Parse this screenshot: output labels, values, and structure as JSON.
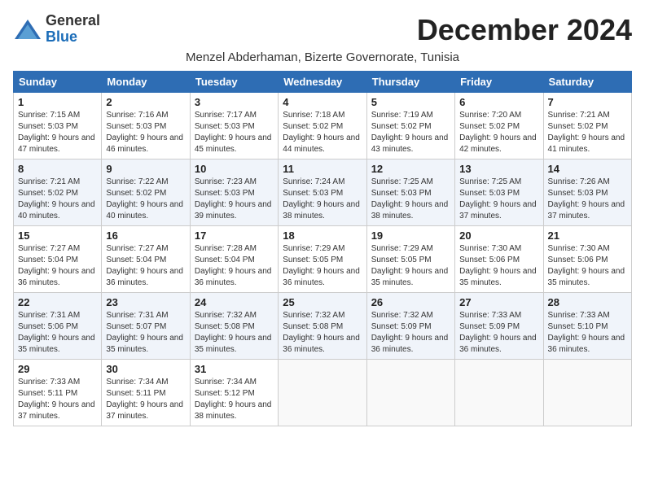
{
  "header": {
    "logo_general": "General",
    "logo_blue": "Blue",
    "month_title": "December 2024",
    "subtitle": "Menzel Abderhaman, Bizerte Governorate, Tunisia"
  },
  "weekdays": [
    "Sunday",
    "Monday",
    "Tuesday",
    "Wednesday",
    "Thursday",
    "Friday",
    "Saturday"
  ],
  "weeks": [
    [
      {
        "day": "1",
        "sunrise": "Sunrise: 7:15 AM",
        "sunset": "Sunset: 5:03 PM",
        "daylight": "Daylight: 9 hours and 47 minutes."
      },
      {
        "day": "2",
        "sunrise": "Sunrise: 7:16 AM",
        "sunset": "Sunset: 5:03 PM",
        "daylight": "Daylight: 9 hours and 46 minutes."
      },
      {
        "day": "3",
        "sunrise": "Sunrise: 7:17 AM",
        "sunset": "Sunset: 5:03 PM",
        "daylight": "Daylight: 9 hours and 45 minutes."
      },
      {
        "day": "4",
        "sunrise": "Sunrise: 7:18 AM",
        "sunset": "Sunset: 5:02 PM",
        "daylight": "Daylight: 9 hours and 44 minutes."
      },
      {
        "day": "5",
        "sunrise": "Sunrise: 7:19 AM",
        "sunset": "Sunset: 5:02 PM",
        "daylight": "Daylight: 9 hours and 43 minutes."
      },
      {
        "day": "6",
        "sunrise": "Sunrise: 7:20 AM",
        "sunset": "Sunset: 5:02 PM",
        "daylight": "Daylight: 9 hours and 42 minutes."
      },
      {
        "day": "7",
        "sunrise": "Sunrise: 7:21 AM",
        "sunset": "Sunset: 5:02 PM",
        "daylight": "Daylight: 9 hours and 41 minutes."
      }
    ],
    [
      {
        "day": "8",
        "sunrise": "Sunrise: 7:21 AM",
        "sunset": "Sunset: 5:02 PM",
        "daylight": "Daylight: 9 hours and 40 minutes."
      },
      {
        "day": "9",
        "sunrise": "Sunrise: 7:22 AM",
        "sunset": "Sunset: 5:02 PM",
        "daylight": "Daylight: 9 hours and 40 minutes."
      },
      {
        "day": "10",
        "sunrise": "Sunrise: 7:23 AM",
        "sunset": "Sunset: 5:03 PM",
        "daylight": "Daylight: 9 hours and 39 minutes."
      },
      {
        "day": "11",
        "sunrise": "Sunrise: 7:24 AM",
        "sunset": "Sunset: 5:03 PM",
        "daylight": "Daylight: 9 hours and 38 minutes."
      },
      {
        "day": "12",
        "sunrise": "Sunrise: 7:25 AM",
        "sunset": "Sunset: 5:03 PM",
        "daylight": "Daylight: 9 hours and 38 minutes."
      },
      {
        "day": "13",
        "sunrise": "Sunrise: 7:25 AM",
        "sunset": "Sunset: 5:03 PM",
        "daylight": "Daylight: 9 hours and 37 minutes."
      },
      {
        "day": "14",
        "sunrise": "Sunrise: 7:26 AM",
        "sunset": "Sunset: 5:03 PM",
        "daylight": "Daylight: 9 hours and 37 minutes."
      }
    ],
    [
      {
        "day": "15",
        "sunrise": "Sunrise: 7:27 AM",
        "sunset": "Sunset: 5:04 PM",
        "daylight": "Daylight: 9 hours and 36 minutes."
      },
      {
        "day": "16",
        "sunrise": "Sunrise: 7:27 AM",
        "sunset": "Sunset: 5:04 PM",
        "daylight": "Daylight: 9 hours and 36 minutes."
      },
      {
        "day": "17",
        "sunrise": "Sunrise: 7:28 AM",
        "sunset": "Sunset: 5:04 PM",
        "daylight": "Daylight: 9 hours and 36 minutes."
      },
      {
        "day": "18",
        "sunrise": "Sunrise: 7:29 AM",
        "sunset": "Sunset: 5:05 PM",
        "daylight": "Daylight: 9 hours and 36 minutes."
      },
      {
        "day": "19",
        "sunrise": "Sunrise: 7:29 AM",
        "sunset": "Sunset: 5:05 PM",
        "daylight": "Daylight: 9 hours and 35 minutes."
      },
      {
        "day": "20",
        "sunrise": "Sunrise: 7:30 AM",
        "sunset": "Sunset: 5:06 PM",
        "daylight": "Daylight: 9 hours and 35 minutes."
      },
      {
        "day": "21",
        "sunrise": "Sunrise: 7:30 AM",
        "sunset": "Sunset: 5:06 PM",
        "daylight": "Daylight: 9 hours and 35 minutes."
      }
    ],
    [
      {
        "day": "22",
        "sunrise": "Sunrise: 7:31 AM",
        "sunset": "Sunset: 5:06 PM",
        "daylight": "Daylight: 9 hours and 35 minutes."
      },
      {
        "day": "23",
        "sunrise": "Sunrise: 7:31 AM",
        "sunset": "Sunset: 5:07 PM",
        "daylight": "Daylight: 9 hours and 35 minutes."
      },
      {
        "day": "24",
        "sunrise": "Sunrise: 7:32 AM",
        "sunset": "Sunset: 5:08 PM",
        "daylight": "Daylight: 9 hours and 35 minutes."
      },
      {
        "day": "25",
        "sunrise": "Sunrise: 7:32 AM",
        "sunset": "Sunset: 5:08 PM",
        "daylight": "Daylight: 9 hours and 36 minutes."
      },
      {
        "day": "26",
        "sunrise": "Sunrise: 7:32 AM",
        "sunset": "Sunset: 5:09 PM",
        "daylight": "Daylight: 9 hours and 36 minutes."
      },
      {
        "day": "27",
        "sunrise": "Sunrise: 7:33 AM",
        "sunset": "Sunset: 5:09 PM",
        "daylight": "Daylight: 9 hours and 36 minutes."
      },
      {
        "day": "28",
        "sunrise": "Sunrise: 7:33 AM",
        "sunset": "Sunset: 5:10 PM",
        "daylight": "Daylight: 9 hours and 36 minutes."
      }
    ],
    [
      {
        "day": "29",
        "sunrise": "Sunrise: 7:33 AM",
        "sunset": "Sunset: 5:11 PM",
        "daylight": "Daylight: 9 hours and 37 minutes."
      },
      {
        "day": "30",
        "sunrise": "Sunrise: 7:34 AM",
        "sunset": "Sunset: 5:11 PM",
        "daylight": "Daylight: 9 hours and 37 minutes."
      },
      {
        "day": "31",
        "sunrise": "Sunrise: 7:34 AM",
        "sunset": "Sunset: 5:12 PM",
        "daylight": "Daylight: 9 hours and 38 minutes."
      },
      null,
      null,
      null,
      null
    ]
  ]
}
